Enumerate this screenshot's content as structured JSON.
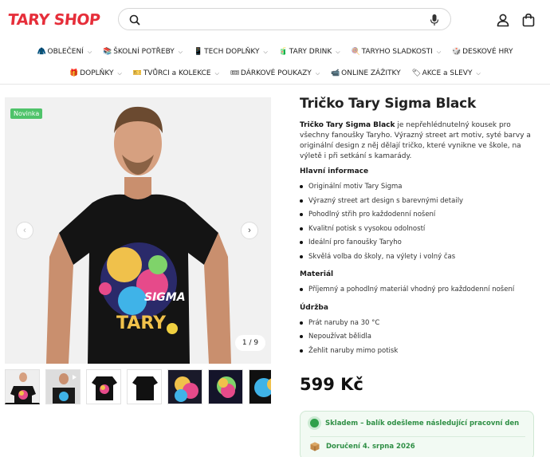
{
  "header": {
    "logo": "TARY SHOP",
    "search_placeholder": ""
  },
  "nav": {
    "row1": [
      {
        "label": "OBLEČENÍ",
        "icon": "🧥",
        "dropdown": true
      },
      {
        "label": "ŠKOLNÍ POTŘEBY",
        "icon": "📚",
        "dropdown": true
      },
      {
        "label": "TECH DOPLŇKY",
        "icon": "📱",
        "dropdown": true
      },
      {
        "label": "TARY DRINK",
        "icon": "🧃",
        "dropdown": true
      },
      {
        "label": "TARYHO SLADKOSTI",
        "icon": "🍭",
        "dropdown": true
      },
      {
        "label": "DESKOVÉ HRY",
        "icon": "🎲",
        "dropdown": false
      }
    ],
    "row2": [
      {
        "label": "DOPLŇKY",
        "icon": "🎁",
        "dropdown": true
      },
      {
        "label": "TVŮRCI a KOLEKCE",
        "icon": "🎫",
        "dropdown": true
      },
      {
        "label": "DÁRKOVÉ POUKAZY",
        "icon": "🎟",
        "dropdown": true
      },
      {
        "label": "ONLINE ZÁŽITKY",
        "icon": "📹",
        "dropdown": false
      },
      {
        "label": "AKCE a SLEVY",
        "icon": "🏷",
        "dropdown": true
      }
    ]
  },
  "gallery": {
    "badge": "Novinka",
    "counter": "1 / 9"
  },
  "product": {
    "title": "Tričko Tary Sigma Black",
    "desc_bold": "Tričko Tary Sigma Black",
    "desc_rest": " je nepřehlédnutelný kousek pro všechny fanoušky Taryho. Výrazný street art motiv, syté barvy a originální design z něj dělají tričko, které vynikne ve škole, na výletě i při setkání s kamarády.",
    "sec_main": "Hlavní informace",
    "main_items": [
      "Originální motiv Tary Sigma",
      "Výrazný street art design s barevnými detaily",
      "Pohodlný střih pro každodenní nošení",
      "Kvalitní potisk s vysokou odolností",
      "Ideální pro fanoušky Taryho",
      "Skvělá volba do školy, na výlety i volný čas"
    ],
    "sec_material": "Materiál",
    "material_items": [
      "Příjemný a pohodlný materiál vhodný pro každodenní nošení"
    ],
    "sec_care": "Údržba",
    "care_items": [
      "Prát naruby na 30 °C",
      "Nepoužívat bělidla",
      "Žehlit naruby mimo potisk"
    ],
    "price": "599 Kč",
    "stock": "Skladem – balík odešleme následující pracovní den",
    "delivery": "Doručení 4. srpna 2026"
  },
  "colors": {
    "brand": "#e62e3a",
    "badge": "#4fc36a",
    "stock": "#2f8f45"
  }
}
